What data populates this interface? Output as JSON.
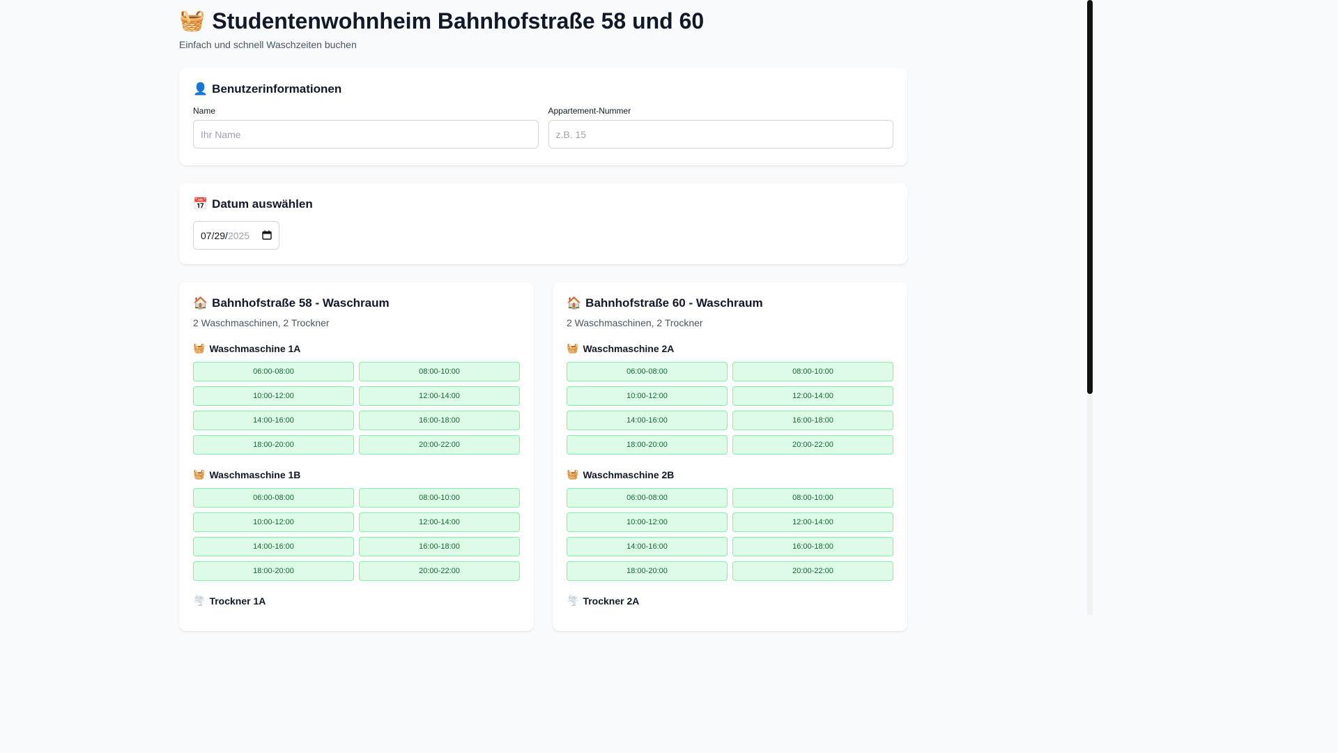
{
  "header": {
    "icon": "laundry-basket-icon",
    "icon_glyph": "🧺",
    "title": "Studentenwohnheim Bahnhofstraße 58 und 60",
    "subtitle": "Einfach und schnell Waschzeiten buchen"
  },
  "user": {
    "icon_glyph": "👤",
    "title": "Benutzerinformationen",
    "name_label": "Name",
    "name_placeholder": "Ihr Name",
    "name_value": "",
    "apartment_label": "Appartement-Nummer",
    "apartment_placeholder": "z.B. 15",
    "apartment_value": ""
  },
  "date": {
    "icon_glyph": "📅",
    "title": "Datum auswählen",
    "month": "07",
    "day": "29",
    "year": "2025",
    "sep": "/"
  },
  "rooms": [
    {
      "icon_glyph": "🏠",
      "title": "Bahnhofstraße 58 - Waschraum",
      "subtitle": "2 Waschmaschinen, 2 Trockner",
      "machines": [
        {
          "icon_glyph": "🧺",
          "name": "Waschmaschine 1A",
          "slots": [
            "06:00-08:00",
            "08:00-10:00",
            "10:00-12:00",
            "12:00-14:00",
            "14:00-16:00",
            "16:00-18:00",
            "18:00-20:00",
            "20:00-22:00"
          ]
        },
        {
          "icon_glyph": "🧺",
          "name": "Waschmaschine 1B",
          "slots": [
            "06:00-08:00",
            "08:00-10:00",
            "10:00-12:00",
            "12:00-14:00",
            "14:00-16:00",
            "16:00-18:00",
            "18:00-20:00",
            "20:00-22:00"
          ]
        },
        {
          "icon_glyph": "🌪️",
          "name": "Trockner 1A",
          "slots": []
        }
      ]
    },
    {
      "icon_glyph": "🏠",
      "title": "Bahnhofstraße 60 - Waschraum",
      "subtitle": "2 Waschmaschinen, 2 Trockner",
      "machines": [
        {
          "icon_glyph": "🧺",
          "name": "Waschmaschine 2A",
          "slots": [
            "06:00-08:00",
            "08:00-10:00",
            "10:00-12:00",
            "12:00-14:00",
            "14:00-16:00",
            "16:00-18:00",
            "18:00-20:00",
            "20:00-22:00"
          ]
        },
        {
          "icon_glyph": "🧺",
          "name": "Waschmaschine 2B",
          "slots": [
            "06:00-08:00",
            "08:00-10:00",
            "10:00-12:00",
            "12:00-14:00",
            "14:00-16:00",
            "16:00-18:00",
            "18:00-20:00",
            "20:00-22:00"
          ]
        },
        {
          "icon_glyph": "🌪️",
          "name": "Trockner 2A",
          "slots": []
        }
      ]
    }
  ],
  "colors": {
    "slot_bg": "#dcfce7",
    "slot_border": "#86efac",
    "slot_text": "#166534",
    "page_bg": "#f8fafc"
  }
}
